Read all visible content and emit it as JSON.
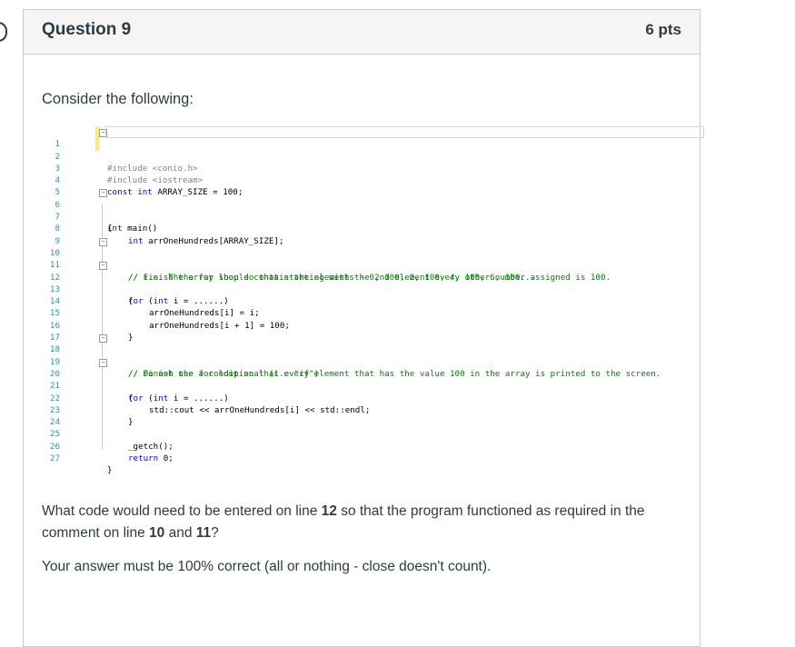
{
  "question": {
    "title": "Question 9",
    "points": "6 pts",
    "intro": "Consider the following:",
    "prompt_part1": "What code would need to be entered on line ",
    "prompt_line_a": "12",
    "prompt_part2": " so that the program functioned as required in the comment on line ",
    "prompt_line_b": "10",
    "prompt_part3": " and ",
    "prompt_line_c": "11",
    "prompt_part4": "?",
    "answer_note": "Your answer must be 100% correct (all or nothing - close doesn't count)."
  },
  "code": {
    "line_numbers": [
      "1",
      "2",
      "3",
      "4",
      "5",
      "6",
      "7",
      "8",
      "9",
      "10",
      "11",
      "12",
      "13",
      "14",
      "15",
      "16",
      "17",
      "18",
      "19",
      "20",
      "21",
      "22",
      "23",
      "24",
      "25",
      "26",
      "27"
    ],
    "l1": "#include <iostream>",
    "l2": "#include <conio.h>",
    "l4_kw": "const int",
    "l4_rest": " ARRAY_SIZE = 100;",
    "l6_kw": "int",
    "l6_rest": " main()",
    "l7": "{",
    "l8_kw": "int",
    "l8_rest": " arrOneHundreds[ARRAY_SIZE];",
    "l10": "// Finish the for loop so that starting with the 2nd element every other number assigned is 100.",
    "l11": "// i.e. The array should contain the elements - 0, 100, 2, 100, 4, 100, 6, 100...",
    "l12_kw1": "for",
    "l12_mid": " (",
    "l12_kw2": "int",
    "l12_rest": " i = ......)",
    "l13": "{",
    "l14": "arrOneHundreds[i] = i;",
    "l15": "arrOneHundreds[i + 1] = 100;",
    "l16": "}",
    "l18": "// Finish the for loop so that every element that has the value 100 in the array is printed to the screen.",
    "l19": "// Do not use a conditional (i.e \"if\")",
    "l20_kw1": "for",
    "l20_mid": " (",
    "l20_kw2": "int",
    "l20_rest": " i = ......)",
    "l21": "{",
    "l22": "std::cout << arrOneHundreds[i] << std::endl;",
    "l23": "}",
    "l25": "_getch();",
    "l26_kw": "return",
    "l26_rest": " 0;",
    "l27": "}"
  }
}
